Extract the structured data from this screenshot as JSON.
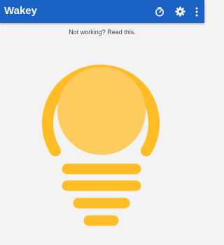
{
  "app": {
    "title": "Wakey",
    "actions": [
      {
        "icon": "timer-icon"
      },
      {
        "icon": "gear-icon"
      },
      {
        "icon": "more-vertical-icon"
      }
    ]
  },
  "main": {
    "help_text": "Not working? Read this.",
    "bulb": {
      "state": "on",
      "ring_color": "#ffbc25",
      "glow_color": "#fdcb5e"
    }
  },
  "colors": {
    "appbar": "#1a62c4",
    "background": "#f3f3f3",
    "accent": "#ffbc25"
  }
}
